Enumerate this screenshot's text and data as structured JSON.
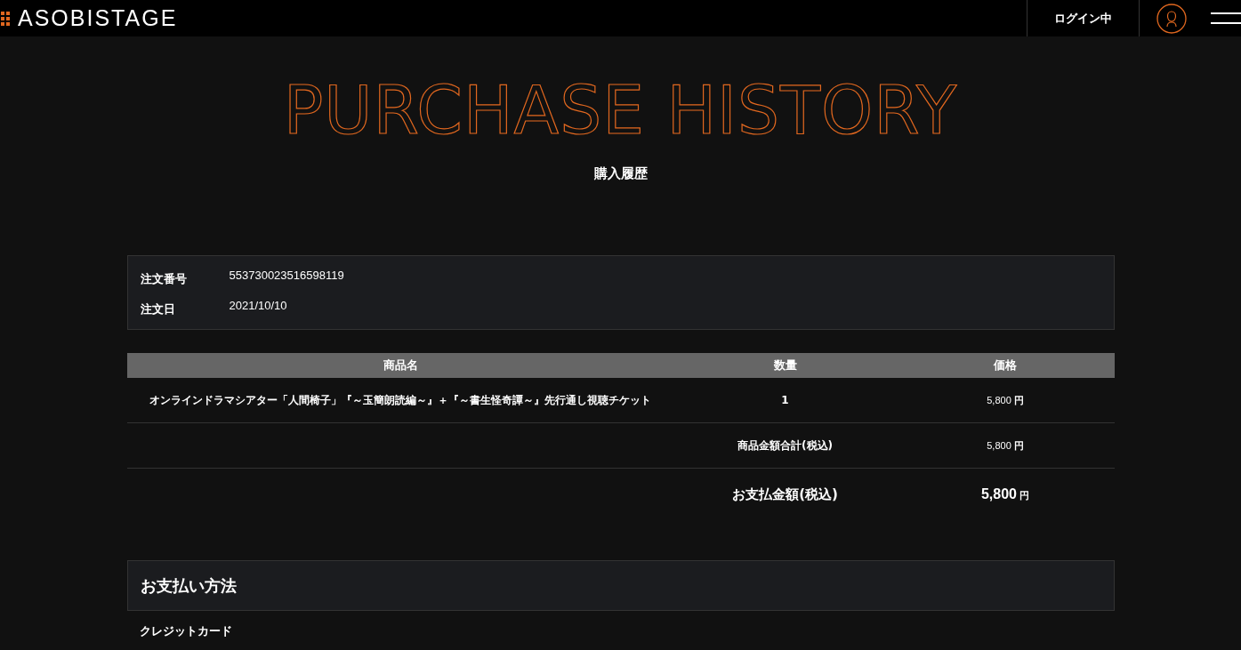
{
  "header": {
    "logo": "ASOBISTAGE",
    "login_status": "ログイン中"
  },
  "page": {
    "title": "PURCHASE HISTORY",
    "subtitle": "購入履歴"
  },
  "order_info": [
    {
      "label": "注文番号",
      "value": "553730023516598119"
    },
    {
      "label": "注文日",
      "value": "2021/10/10"
    }
  ],
  "table": {
    "columns": [
      "商品名",
      "数量",
      "価格"
    ],
    "rows": [
      {
        "name": "オンラインドラマシアター「人間椅子」『～玉簡朗読編～』＋『～書生怪奇譚～』先行通し視聴チケット",
        "quantity": "1",
        "price": "5,800",
        "currency": "円"
      }
    ],
    "subtotal": {
      "label": "商品金額合計(税込)",
      "price": "5,800",
      "currency": "円"
    },
    "total": {
      "label": "お支払金額(税込)",
      "price": "5,800",
      "currency": "円"
    }
  },
  "payment": {
    "heading": "お支払い方法",
    "method": "クレジットカード"
  }
}
